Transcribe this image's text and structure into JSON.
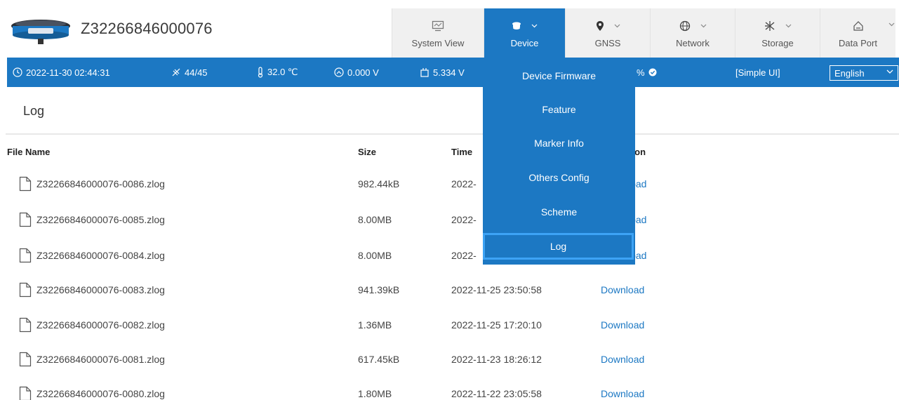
{
  "header": {
    "device_serial": "Z32266846000076",
    "nav": [
      {
        "label": "System View",
        "icon": "monitor-icon"
      },
      {
        "label": "Device",
        "icon": "device-icon"
      },
      {
        "label": "GNSS",
        "icon": "location-pin-icon"
      },
      {
        "label": "Network",
        "icon": "globe-icon"
      },
      {
        "label": "Storage",
        "icon": "storage-icon"
      },
      {
        "label": "Data Port",
        "icon": "data-port-icon"
      }
    ]
  },
  "status": {
    "datetime": "2022-11-30 02:44:31",
    "satellites": "44/45",
    "temperature": "32.0 ℃",
    "voltage1": "0.000 V",
    "voltage2": "5.334 V",
    "battery_tail": "%",
    "simple_ui": "[Simple UI]",
    "language": "English"
  },
  "dropdown": {
    "items": [
      "Device Firmware",
      "Feature",
      "Marker Info",
      "Others Config",
      "Scheme",
      "Log"
    ],
    "active": "Log"
  },
  "page": {
    "title": "Log"
  },
  "table": {
    "headers": {
      "file_name": "File Name",
      "size": "Size",
      "time": "Time",
      "operation_partial": "ation"
    },
    "rows": [
      {
        "name": "Z32266846000076-0086.zlog",
        "size": "982.44kB",
        "time": "2022-",
        "action": "load"
      },
      {
        "name": "Z32266846000076-0085.zlog",
        "size": "8.00MB",
        "time": "2022-",
        "action": "load"
      },
      {
        "name": "Z32266846000076-0084.zlog",
        "size": "8.00MB",
        "time": "2022-",
        "action": "load"
      },
      {
        "name": "Z32266846000076-0083.zlog",
        "size": "941.39kB",
        "time": "2022-11-25 23:50:58",
        "action": "Download"
      },
      {
        "name": "Z32266846000076-0082.zlog",
        "size": "1.36MB",
        "time": "2022-11-25 17:20:10",
        "action": "Download"
      },
      {
        "name": "Z32266846000076-0081.zlog",
        "size": "617.45kB",
        "time": "2022-11-23 18:26:12",
        "action": "Download"
      },
      {
        "name": "Z32266846000076-0080.zlog",
        "size": "1.80MB",
        "time": "2022-11-22 23:05:58",
        "action": "Download"
      }
    ]
  },
  "colors": {
    "accent": "#1c78c3",
    "nav_bg": "#f0f0f0",
    "dropdown_highlight": "#3da3f5"
  }
}
